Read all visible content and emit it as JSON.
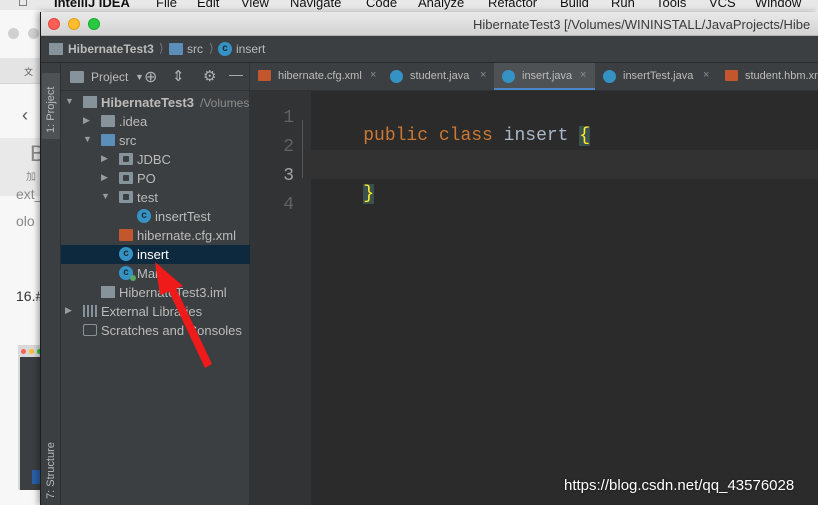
{
  "menubar": {
    "app": "IntelliJ IDEA",
    "items": [
      "File",
      "Edit",
      "View",
      "Navigate",
      "Code",
      "Analyze",
      "Refactor",
      "Build",
      "Run",
      "Tools",
      "VCS",
      "Window"
    ]
  },
  "background": {
    "tab_text": "文",
    "texts": [
      "B",
      "加",
      "ext_",
      "olo",
      "16.#"
    ]
  },
  "window": {
    "title": "HibernateTest3 [/Volumes/WININSTALL/JavaProjects/Hibe"
  },
  "navbar": {
    "crumbs": [
      "HibernateTest3",
      "src",
      "insert"
    ]
  },
  "left_strip": {
    "project_tab": "1: Project",
    "structure_tab": "7: Structure"
  },
  "project_panel": {
    "label": "Project",
    "root": {
      "name": "HibernateTest3",
      "path": "/Volumes"
    },
    "items": [
      ".idea",
      "src",
      "JDBC",
      "PO",
      "test",
      "insertTest",
      "hibernate.cfg.xml",
      "insert",
      "Main",
      "HibernateTest3.iml",
      "External Libraries",
      "Scratches and Consoles"
    ]
  },
  "tabs": [
    {
      "label": "hibernate.cfg.xml",
      "close": "×"
    },
    {
      "label": "student.java",
      "close": "×"
    },
    {
      "label": "insert.java",
      "close": "×"
    },
    {
      "label": "insertTest.java",
      "close": "×"
    },
    {
      "label": "student.hbm.xm",
      "close": ""
    }
  ],
  "editor": {
    "line_numbers": [
      "1",
      "2",
      "3",
      "4"
    ],
    "code": {
      "kw1": "public",
      "kw2": "class",
      "name": "insert",
      "open": "{",
      "close": "}"
    }
  },
  "watermark": "https://blog.csdn.net/qq_43576028",
  "colors": {
    "accent": "#4a88c7",
    "keyword": "#cc7832",
    "brace": "#ffef28",
    "arrow": "#ef1a1a"
  }
}
